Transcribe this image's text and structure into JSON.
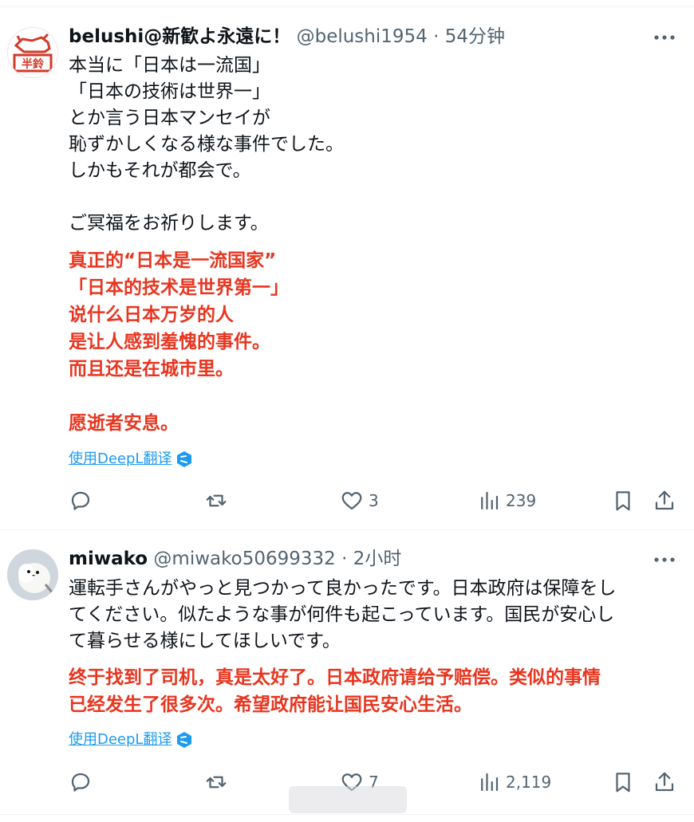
{
  "colors": {
    "text": "#0f1419",
    "muted": "#536471",
    "link": "#1d9bf0",
    "translation": "#e8351f",
    "divider": "#eff3f4"
  },
  "tweets": [
    {
      "name": "belushi@新歓よ永遠に！",
      "handle": "@belushi1954",
      "dot": "·",
      "time": "54分钟",
      "avatar_icon": "stamp-avatar-icon",
      "avatar_text": "半鈴",
      "text_jp": "本当に「日本は一流国」\n「日本の技術は世界一」\nとか言う日本マンセイが\n恥ずかしくなる様な事件でした。\nしかもそれが都会で。\n\nご冥福をお祈りします。",
      "text_cn": "真正的“日本是一流国家”\n「日本的技术是世界第一」\n说什么日本万岁的人\n是让人感到羞愧的事件。\n而且还是在城市里。\n\n愿逝者安息。",
      "translate_label": "使用DeepL翻译",
      "reply_count": "",
      "retweet_count": "",
      "like_count": "3",
      "view_count": "239"
    },
    {
      "name": "miwako",
      "handle": "@miwako50699332",
      "dot": "·",
      "time": "2小时",
      "avatar_icon": "bird-avatar-icon",
      "text_jp": "運転手さんがやっと見つかって良かったです。日本政府は保障をし\nてください。似たような事が何件も起こっています。国民が安心し\nて暮らせる様にしてほしいです。",
      "text_cn": "终于找到了司机，真是太好了。日本政府请给予赔偿。类似的事情\n已经发生了很多次。希望政府能让国民安心生活。",
      "translate_label": "使用DeepL翻译",
      "reply_count": "",
      "retweet_count": "",
      "like_count": "7",
      "view_count": "2,119"
    }
  ]
}
